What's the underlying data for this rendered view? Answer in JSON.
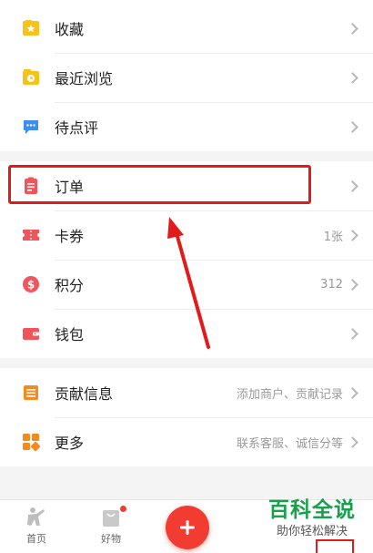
{
  "menu": {
    "favorites": {
      "label": "收藏",
      "icon": "star-folder-icon",
      "color": "#f7c21a"
    },
    "recent": {
      "label": "最近浏览",
      "icon": "clock-folder-icon",
      "color": "#f7c21a"
    },
    "pending_review": {
      "label": "待点评",
      "icon": "chat-bubble-icon",
      "color": "#3d8ef0"
    },
    "orders": {
      "label": "订单",
      "icon": "clipboard-icon",
      "color": "#f2545b"
    },
    "coupons": {
      "label": "卡券",
      "value": "1张",
      "icon": "ticket-icon",
      "color": "#f2545b"
    },
    "points": {
      "label": "积分",
      "value": "312",
      "icon": "dollar-circle-icon",
      "color": "#f2545b"
    },
    "wallet": {
      "label": "钱包",
      "icon": "wallet-icon",
      "color": "#f2545b"
    },
    "contribution": {
      "label": "贡献信息",
      "value": "添加商户、贡献记录",
      "icon": "document-icon",
      "color": "#f58a1f"
    },
    "more": {
      "label": "更多",
      "value": "联系客服、诚信分等",
      "icon": "grid-icon",
      "color": "#f58a1f"
    }
  },
  "tabbar": {
    "home": {
      "label": "首页"
    },
    "goods": {
      "label": "好物"
    }
  },
  "watermark": {
    "title": "百科全说",
    "subtitle": "助你轻松解决"
  },
  "accent_red": "#e31a1a"
}
